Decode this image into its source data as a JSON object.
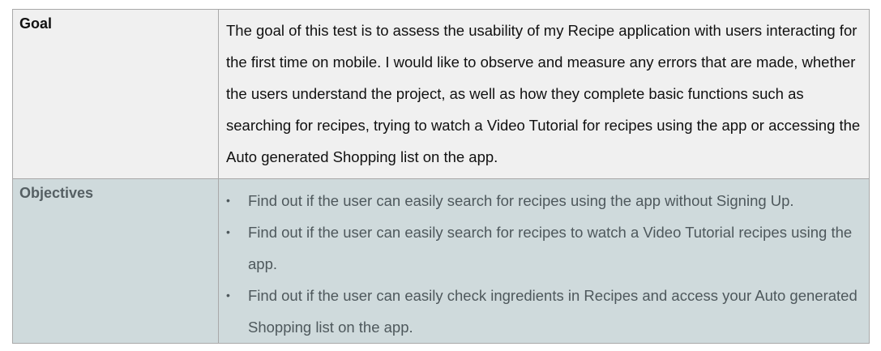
{
  "goal": {
    "label": "Goal",
    "text": "The goal of this test is to assess the usability of my Recipe application with users interacting for the first time on mobile. I would like to observe and measure any errors that are made, whether the users understand the project, as well as how they complete basic functions such as searching for recipes, trying to watch a Video Tutorial  for recipes using the app  or accessing the Auto generated Shopping list on the app."
  },
  "objectives": {
    "label": "Objectives",
    "items": [
      "Find out if the user can easily search for recipes using the app without Signing Up.",
      "Find out if the user can easily search for recipes to watch a Video Tutorial recipes using the app.",
      "Find out if the user can easily check ingredients in Recipes and access your Auto generated Shopping list on the app."
    ]
  }
}
